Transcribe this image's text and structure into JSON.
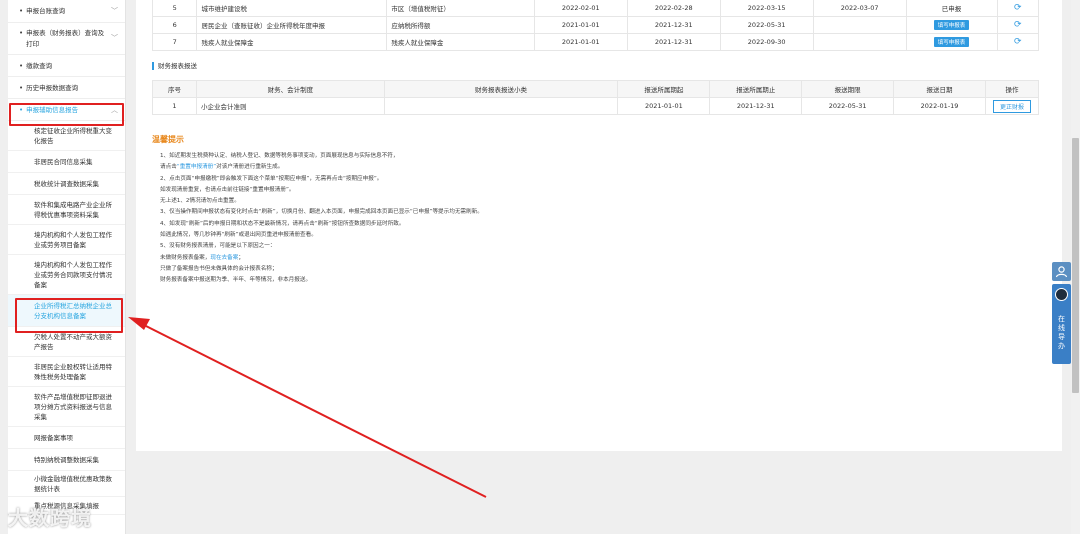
{
  "sidebar": {
    "top_items": [
      {
        "label": "申报台账查询",
        "chevron": "﹀"
      },
      {
        "label": "申报表（财务报表）查询及打印",
        "chevron": "﹀"
      },
      {
        "label": "缴款查询",
        "chevron": ""
      },
      {
        "label": "历史申报数据查询",
        "chevron": ""
      },
      {
        "label": "申报辅助信息报告",
        "chevron": "︿"
      }
    ],
    "sub_items": [
      "核定征收企业所得税重大变化报告",
      "非居民合同信息采集",
      "税收统计调查数据采集",
      "软件和集成电路产业企业所得税优惠事项资料采集",
      "境内机构和个人发包工程作业或劳务项目备案",
      "境内机构和个人发包工程作业或劳务合同款项支付情况备案",
      "企业所得税汇总纳税企业总分支机构信息备案",
      "欠税人处置不动产或大额资产报告",
      "非居民企业股权转让适用特殊性税务处理备案",
      "软件产品增值税即征即退进项分摊方式资料报送与信息采集",
      "网报备案事项",
      "特别纳税调整数据采集",
      "小微金融增值税优惠政策数据统计表",
      "重点税源信息采集填报"
    ]
  },
  "top_table": {
    "rows": [
      {
        "no": "5",
        "name": "城市维护建设税",
        "item": "市区（增值税附征）",
        "start": "2022-02-01",
        "end": "2022-02-28",
        "deadline": "2022-03-15",
        "date": "2022-03-07",
        "status": "已申报",
        "action": ""
      },
      {
        "no": "6",
        "name": "居民企业（查账征收）企业所得税年度申报",
        "item": "应纳税所得额",
        "start": "2021-01-01",
        "end": "2021-12-31",
        "deadline": "2022-05-31",
        "date": "",
        "status": "",
        "action": "填写申报表"
      },
      {
        "no": "7",
        "name": "残疾人就业保障金",
        "item": "残疾人就业保障金",
        "start": "2021-01-01",
        "end": "2021-12-31",
        "deadline": "2022-09-30",
        "date": "",
        "status": "",
        "action": "填写申报表"
      }
    ]
  },
  "fin_section": {
    "title": "财务报表报送",
    "headers": [
      "序号",
      "财务、会计制度",
      "财务报表报送小类",
      "报送所属期起",
      "报送所属期止",
      "报送期限",
      "报送日期",
      "操作"
    ],
    "rows": [
      {
        "no": "1",
        "system": "小企业会计准则",
        "subclass": "",
        "start": "2021-01-01",
        "end": "2021-12-31",
        "deadline": "2022-05-31",
        "date": "2022-01-19",
        "action": "更正财报"
      }
    ]
  },
  "tips": {
    "title": "温馨提示",
    "lines": [
      {
        "pre": "1、如近期发生税费种认定、纳税人登记、数据等税务事项变动，页面展现信息与实际信息不符，",
        "link": "",
        "post": ""
      },
      {
        "pre": "请点击",
        "link": "“重置申报清册”",
        "post": "对该户清册进行重新生成。"
      },
      {
        "pre": "2、点击页面“申报缴税”即会触发下面这个菜单“按期应申报”，无需再点击“按期应申报”。",
        "link": "",
        "post": ""
      },
      {
        "pre": "如发现清册重复，也请点击前往链接“重置申报清册”。",
        "link": "",
        "post": ""
      },
      {
        "pre": "无上述1、2情况请勿点击重置。",
        "link": "",
        "post": ""
      },
      {
        "pre": "3、仅当操作期间申报状态有变化时点击“刷新”，切换月份、翻进入本页面，申报完成回本页面已显示“已申报”等提示均无需刷新。",
        "link": "",
        "post": ""
      },
      {
        "pre": "4、如发现“刷新”后的申报日期和状态不是最新情况，请再点击“刷新”按钮所查数据同步延时所致。",
        "link": "",
        "post": ""
      },
      {
        "pre": "如遇此情况，等几秒钟再“刷新”或退出网页重进申报清册查看。",
        "link": "",
        "post": ""
      },
      {
        "pre": "5、没有财务报表清册，可能是以下原因之一：",
        "link": "",
        "post": ""
      },
      {
        "pre": "未做财务报表备案，",
        "link": "现在去备案",
        "post": "；"
      },
      {
        "pre": "只做了备案报告书但未做具体的会计报表名称；",
        "link": "",
        "post": ""
      },
      {
        "pre": "财务报表备案中报送期为季、半年、年等情况，非本月报送。",
        "link": "",
        "post": ""
      }
    ]
  },
  "float_help": {
    "label": "在线导办"
  },
  "watermark": "大数跨境",
  "colors": {
    "accent": "#2f9ae0",
    "annotation": "#e02020",
    "tips_title": "#e8891f"
  }
}
